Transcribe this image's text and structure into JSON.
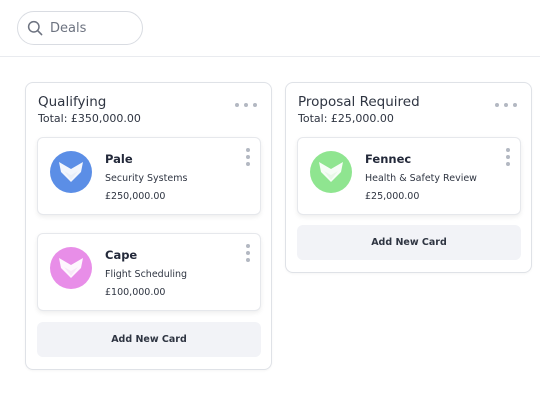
{
  "search": {
    "placeholder": "Deals",
    "value": ""
  },
  "columns": [
    {
      "title": "Qualifying",
      "total": "Total: £350,000.00",
      "cards": [
        {
          "name": "Pale",
          "description": "Security Systems",
          "value": "£250,000.00",
          "avatar_color": "#5b8ee6",
          "icon": "fox-icon"
        },
        {
          "name": "Cape",
          "description": "Flight Scheduling",
          "value": "£100,000.00",
          "avatar_color": "#e88ee8",
          "icon": "fox-icon"
        }
      ],
      "add_card_label": "Add New Card"
    },
    {
      "title": "Proposal Required",
      "total": "Total: £25,000.00",
      "cards": [
        {
          "name": "Fennec",
          "description": "Health & Safety Review",
          "value": "£25,000.00",
          "avatar_color": "#8fe590",
          "icon": "fox-icon"
        }
      ],
      "add_card_label": "Add New Card"
    }
  ]
}
